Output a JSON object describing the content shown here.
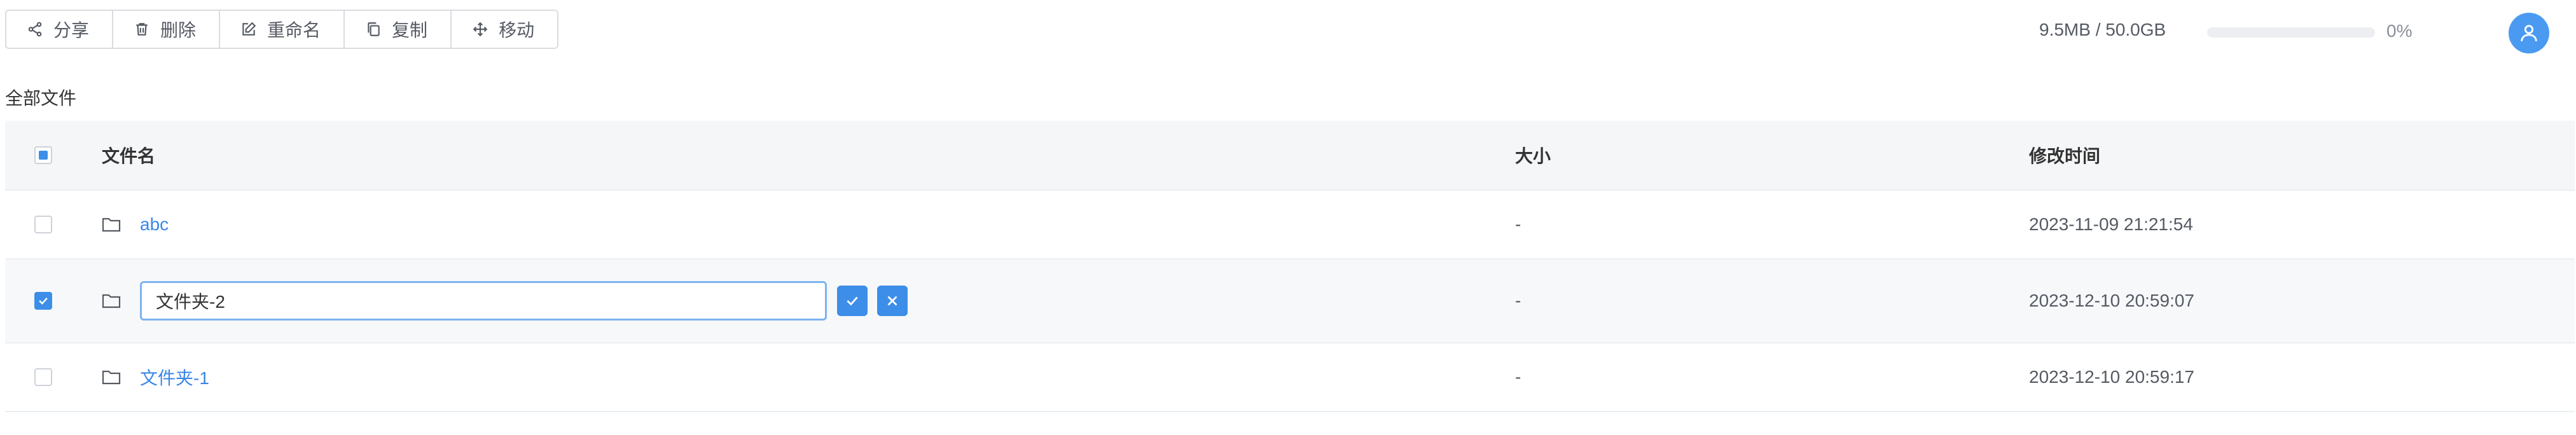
{
  "toolbar": {
    "share_label": "分享",
    "delete_label": "删除",
    "rename_label": "重命名",
    "copy_label": "复制",
    "move_label": "移动"
  },
  "storage": {
    "usage_text": "9.5MB / 50.0GB",
    "percent_text": "0%",
    "fill_fraction": 0.0
  },
  "breadcrumb": {
    "label": "全部文件"
  },
  "table": {
    "headers": {
      "name": "文件名",
      "size": "大小",
      "modified": "修改时间"
    },
    "rows": [
      {
        "name": "abc",
        "size": "-",
        "modified": "2023-11-09 21:21:54",
        "selected": false
      },
      {
        "name": "文件夹-2",
        "size": "-",
        "modified": "2023-12-10 20:59:07",
        "selected": true,
        "editing": true
      },
      {
        "name": "文件夹-1",
        "size": "-",
        "modified": "2023-12-10 20:59:17",
        "selected": false
      }
    ]
  },
  "icons": {
    "share": "share-icon",
    "delete": "trash-icon",
    "rename": "edit-icon",
    "copy": "copy-icon",
    "move": "move-icon",
    "folder": "folder-icon",
    "avatar": "user-icon"
  },
  "colors": {
    "accent": "#3d8ee8",
    "link": "#3a86e8",
    "header_bg": "#f5f6f8"
  }
}
